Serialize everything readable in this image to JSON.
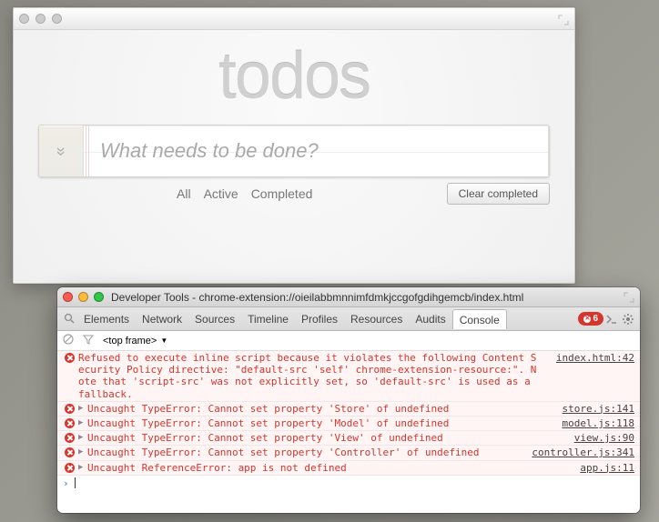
{
  "app": {
    "title": "todos",
    "input_placeholder": "What needs to be done?",
    "toggle_all_glyph": "»",
    "filters": {
      "all": "All",
      "active": "Active",
      "completed": "Completed"
    },
    "clear_label": "Clear completed"
  },
  "devtools": {
    "window_title": "Developer Tools - chrome-extension://oieilabbmnnimfdmkjccgofgdihgemcb/index.html",
    "tabs": {
      "elements": "Elements",
      "network": "Network",
      "sources": "Sources",
      "timeline": "Timeline",
      "profiles": "Profiles",
      "resources": "Resources",
      "audits": "Audits",
      "console": "Console"
    },
    "error_count": "6",
    "context_frame": "<top frame>",
    "console": [
      {
        "expandable": false,
        "message": "Refused to execute inline script because it violates the following Content Security Policy directive: \"default-src 'self' chrome-extension-resource:\". Note that 'script-src' was not explicitly set, so 'default-src' is used as a fallback.",
        "source": "index.html:42"
      },
      {
        "expandable": true,
        "message": "Uncaught TypeError: Cannot set property 'Store' of undefined",
        "source": "store.js:141"
      },
      {
        "expandable": true,
        "message": "Uncaught TypeError: Cannot set property 'Model' of undefined",
        "source": "model.js:118"
      },
      {
        "expandable": true,
        "message": "Uncaught TypeError: Cannot set property 'View' of undefined",
        "source": "view.js:90"
      },
      {
        "expandable": true,
        "message": "Uncaught TypeError: Cannot set property 'Controller' of undefined",
        "source": "controller.js:341"
      },
      {
        "expandable": true,
        "message": "Uncaught ReferenceError: app is not defined",
        "source": "app.js:11"
      }
    ]
  }
}
